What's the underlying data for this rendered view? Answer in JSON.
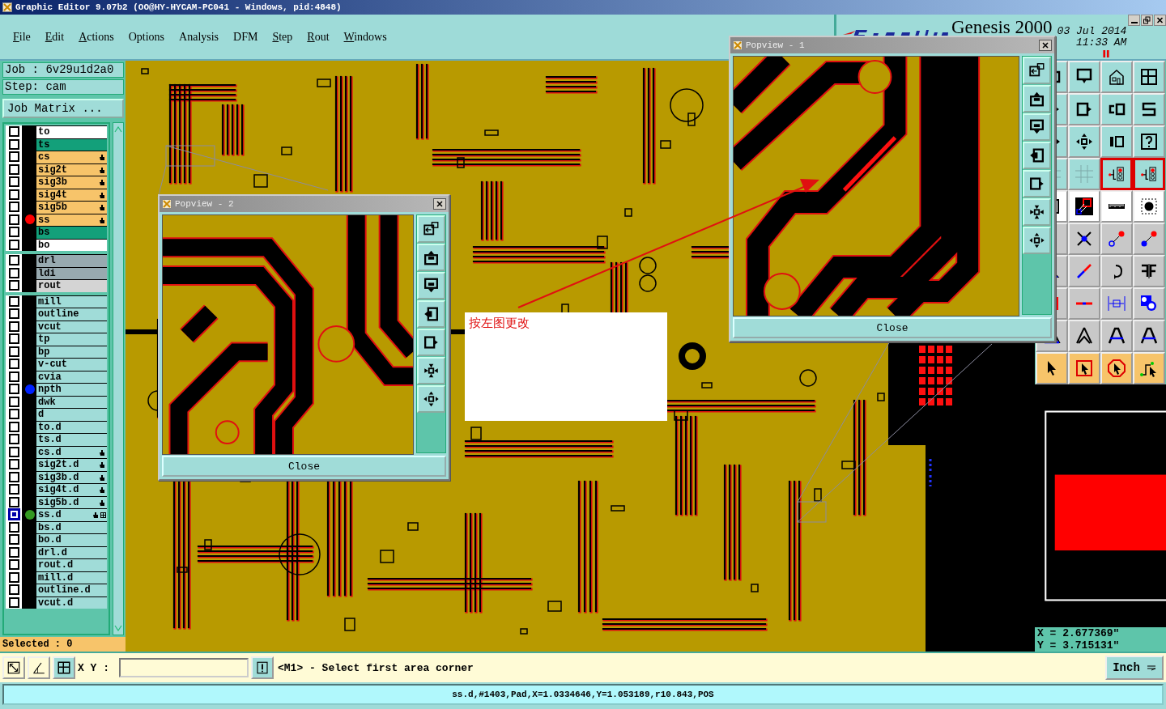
{
  "window": {
    "title": "Graphic Editor 9.07b2 (OO@HY-HYCAM-PC041 - Windows, pid:4848)"
  },
  "menu": [
    {
      "label": "File",
      "underline": true
    },
    {
      "label": "Edit",
      "underline": true
    },
    {
      "label": "Actions",
      "underline": true
    },
    {
      "label": "Options",
      "underline": false
    },
    {
      "label": "Analysis",
      "underline": false
    },
    {
      "label": "DFM",
      "underline": false
    },
    {
      "label": "Step",
      "underline": true
    },
    {
      "label": "Rout",
      "underline": true
    },
    {
      "label": "Windows",
      "underline": true
    }
  ],
  "header": {
    "product": "Genesis 2000",
    "date": "03 Jul 2014",
    "time": "11:33 AM"
  },
  "job": {
    "job": "Job : 6v29u1d2a0",
    "step": "Step: cam",
    "matrix_button": "Job Matrix ..."
  },
  "layer_groups": [
    [
      {
        "name": "to",
        "kind": "silk",
        "affected": false,
        "selected": false
      },
      {
        "name": "ts",
        "kind": "mask",
        "affected": false,
        "selected": false
      },
      {
        "name": "cs",
        "kind": "signal",
        "affected": true,
        "selected": false
      },
      {
        "name": "sig2t",
        "kind": "signal",
        "affected": true,
        "selected": false
      },
      {
        "name": "sig3b",
        "kind": "signal",
        "affected": true,
        "selected": false
      },
      {
        "name": "sig4t",
        "kind": "signal",
        "affected": true,
        "selected": false
      },
      {
        "name": "sig5b",
        "kind": "signal",
        "affected": true,
        "selected": false
      },
      {
        "name": "ss",
        "kind": "signal",
        "affected": true,
        "selected": false,
        "color": "#ff0000"
      },
      {
        "name": "bs",
        "kind": "mask",
        "affected": false,
        "selected": false
      },
      {
        "name": "bo",
        "kind": "silk",
        "affected": false,
        "selected": false
      }
    ],
    [
      {
        "name": "drl",
        "kind": "drill",
        "affected": false,
        "selected": false
      },
      {
        "name": "ldi",
        "kind": "drill",
        "affected": false,
        "selected": false
      },
      {
        "name": "rout",
        "kind": "rout",
        "affected": false,
        "selected": false
      }
    ],
    [
      {
        "name": "mill",
        "kind": "misc",
        "affected": false,
        "selected": false
      },
      {
        "name": "outline",
        "kind": "misc",
        "affected": false,
        "selected": false
      },
      {
        "name": "vcut",
        "kind": "misc",
        "affected": false,
        "selected": false
      },
      {
        "name": "tp",
        "kind": "misc",
        "affected": false,
        "selected": false
      },
      {
        "name": "bp",
        "kind": "misc",
        "affected": false,
        "selected": false
      },
      {
        "name": "v-cut",
        "kind": "misc",
        "affected": false,
        "selected": false
      },
      {
        "name": "cvia",
        "kind": "misc",
        "affected": false,
        "selected": false
      },
      {
        "name": "npth",
        "kind": "misc",
        "affected": false,
        "selected": false,
        "color": "#0022ff"
      },
      {
        "name": "dwk",
        "kind": "misc",
        "affected": false,
        "selected": false
      },
      {
        "name": "d",
        "kind": "misc",
        "affected": false,
        "selected": false
      },
      {
        "name": "to.d",
        "kind": "misc",
        "affected": false,
        "selected": false
      },
      {
        "name": "ts.d",
        "kind": "misc",
        "affected": false,
        "selected": false
      },
      {
        "name": "cs.d",
        "kind": "misc",
        "affected": true,
        "selected": false
      },
      {
        "name": "sig2t.d",
        "kind": "misc",
        "affected": true,
        "selected": false
      },
      {
        "name": "sig3b.d",
        "kind": "misc",
        "affected": true,
        "selected": false
      },
      {
        "name": "sig4t.d",
        "kind": "misc",
        "affected": true,
        "selected": false
      },
      {
        "name": "sig5b.d",
        "kind": "misc",
        "affected": true,
        "selected": false
      },
      {
        "name": "ss.d",
        "kind": "misc",
        "affected": true,
        "selected": true,
        "color": "#339922"
      },
      {
        "name": "bs.d",
        "kind": "misc",
        "affected": false,
        "selected": false
      },
      {
        "name": "bo.d",
        "kind": "misc",
        "affected": false,
        "selected": false
      },
      {
        "name": "drl.d",
        "kind": "misc",
        "affected": false,
        "selected": false
      },
      {
        "name": "rout.d",
        "kind": "misc",
        "affected": false,
        "selected": false
      },
      {
        "name": "mill.d",
        "kind": "misc",
        "affected": false,
        "selected": false
      },
      {
        "name": "outline.d",
        "kind": "misc",
        "affected": false,
        "selected": false
      },
      {
        "name": "vcut.d",
        "kind": "misc",
        "affected": false,
        "selected": false
      }
    ]
  ],
  "selected_count": "Selected : 0",
  "tools": [
    {
      "kind": "teal"
    },
    {
      "kind": "teal"
    },
    {
      "kind": "teal"
    },
    {
      "kind": "teal"
    },
    {
      "kind": "teal"
    },
    {
      "kind": "teal"
    },
    {
      "kind": "teal"
    },
    {
      "kind": "teal"
    },
    {
      "kind": "teal"
    },
    {
      "kind": "teal"
    },
    {
      "kind": "teal"
    },
    {
      "kind": "teal"
    },
    {
      "kind": "teal"
    },
    {
      "kind": "teal"
    },
    {
      "kind": "red"
    },
    {
      "kind": "red"
    },
    {
      "kind": "white"
    },
    {
      "kind": "white"
    },
    {
      "kind": "white"
    },
    {
      "kind": "white"
    },
    {
      "kind": "gray"
    },
    {
      "kind": "gray"
    },
    {
      "kind": "gray"
    },
    {
      "kind": "gray"
    },
    {
      "kind": "gray"
    },
    {
      "kind": "gray"
    },
    {
      "kind": "gray"
    },
    {
      "kind": "gray"
    },
    {
      "kind": "gray"
    },
    {
      "kind": "gray"
    },
    {
      "kind": "gray"
    },
    {
      "kind": "gray"
    },
    {
      "kind": "gray"
    },
    {
      "kind": "gray"
    },
    {
      "kind": "gray"
    },
    {
      "kind": "gray"
    },
    {
      "kind": "yellow"
    },
    {
      "kind": "yellow"
    },
    {
      "kind": "yellow"
    },
    {
      "kind": "yellow"
    }
  ],
  "coordinates": {
    "x": "X = 2.677369\"",
    "y": "Y = 3.715131\""
  },
  "popviews": [
    {
      "title": "Popview - 2",
      "close": "Close"
    },
    {
      "title": "Popview - 1",
      "close": "Close"
    }
  ],
  "annotation": {
    "note": "按左图更改"
  },
  "command": {
    "label": "X Y :",
    "message": "<M1> - Select first area corner",
    "units": "Inch"
  },
  "status": "ss.d,#1403,Pad,X=1.0334646,Y=1.053189,r10.843,POS"
}
